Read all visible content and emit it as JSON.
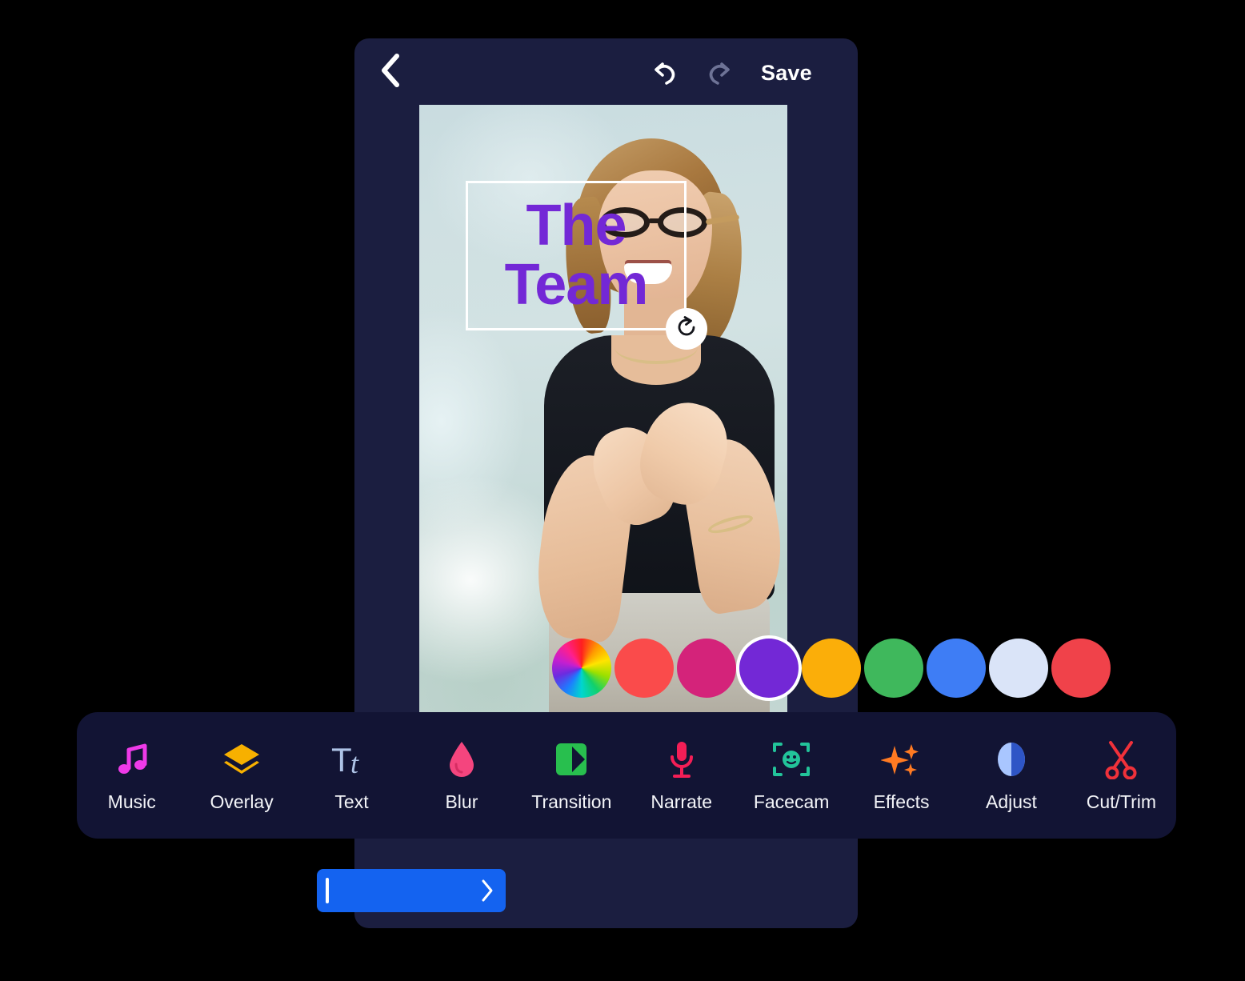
{
  "app": {
    "background_color": "#000000",
    "frame_color": "#1B1E40",
    "toolbar_color": "#121434"
  },
  "header": {
    "back_icon": "chevron-left-icon",
    "undo_icon": "undo-arrow-icon",
    "redo_icon": "redo-arrow-icon",
    "save_label": "Save",
    "undo_enabled_color": "#FFFFFF",
    "redo_disabled_color": "#6E7396"
  },
  "preview": {
    "text_overlay": {
      "content": "The\nTeam",
      "color": "#7328D6",
      "selected": true,
      "rotate_handle_icon": "rotate-clockwise-icon"
    }
  },
  "color_swatches": {
    "selected_index": 3,
    "items": [
      {
        "name": "color-wheel",
        "hex": "rainbow"
      },
      {
        "name": "coral-red",
        "hex": "#FA4B4B"
      },
      {
        "name": "magenta-pink",
        "hex": "#D4237A"
      },
      {
        "name": "purple",
        "hex": "#7328D6"
      },
      {
        "name": "amber",
        "hex": "#FBAE09"
      },
      {
        "name": "green",
        "hex": "#3FB85C"
      },
      {
        "name": "blue",
        "hex": "#3E7DF5"
      },
      {
        "name": "pale-lavender",
        "hex": "#DAE4F8"
      },
      {
        "name": "red",
        "hex": "#F0424A"
      }
    ]
  },
  "toolbar": {
    "items": [
      {
        "label": "Music",
        "icon": "music-note-icon",
        "color": "#EE3AE8"
      },
      {
        "label": "Overlay",
        "icon": "layers-icon",
        "color": "#F7B000"
      },
      {
        "label": "Text",
        "icon": "text-tt-icon",
        "color": "#AEC3E6"
      },
      {
        "label": "Blur",
        "icon": "water-drop-icon",
        "color": "#F4457E"
      },
      {
        "label": "Transition",
        "icon": "transition-icon",
        "color": "#28BF4E"
      },
      {
        "label": "Narrate",
        "icon": "microphone-icon",
        "color": "#F41E56"
      },
      {
        "label": "Facecam",
        "icon": "face-frame-icon",
        "color": "#22C49A"
      },
      {
        "label": "Effects",
        "icon": "sparkles-icon",
        "color": "#FF7A22"
      },
      {
        "label": "Adjust",
        "icon": "contrast-icon",
        "color": "#7EA8FF"
      },
      {
        "label": "Cut/Trim",
        "icon": "scissors-icon",
        "color": "#F0313A"
      }
    ]
  },
  "timeline": {
    "clip_color": "#1463F0",
    "left_handle_icon": "trim-handle-icon",
    "right_handle_icon": "chevron-right-icon"
  }
}
